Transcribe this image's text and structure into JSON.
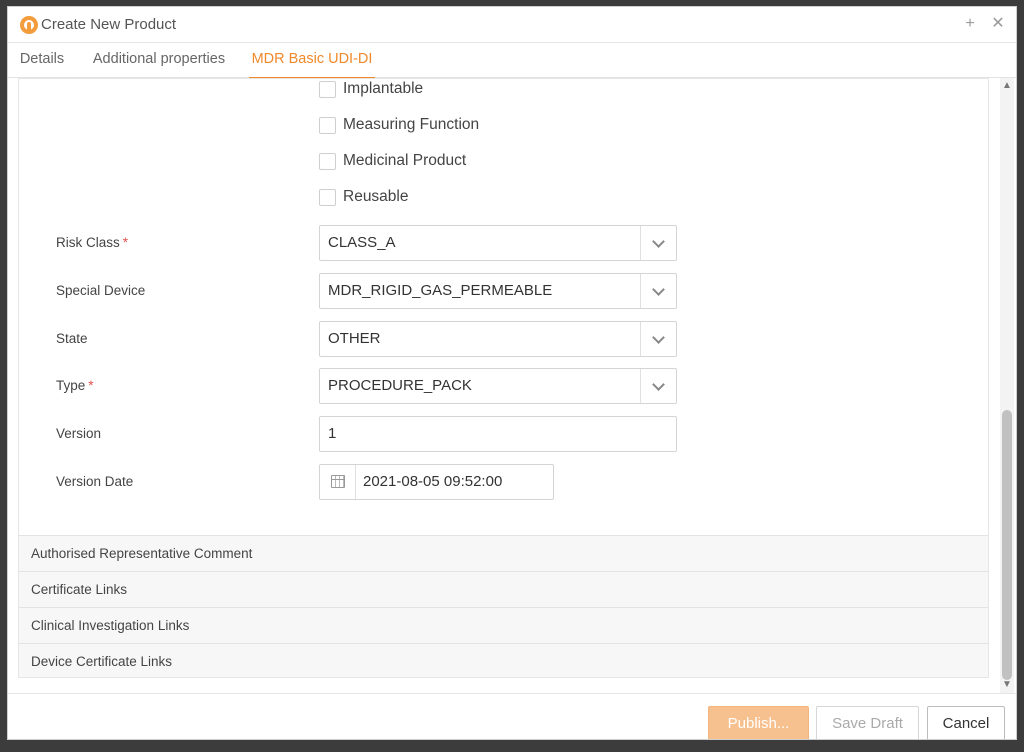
{
  "window": {
    "title": "Create New Product",
    "add_glyph": "+",
    "close_glyph": "✕"
  },
  "tabs": [
    {
      "label": "Details"
    },
    {
      "label": "Additional properties"
    },
    {
      "label": "MDR Basic UDI-DI",
      "active": true
    }
  ],
  "checkboxes": [
    {
      "label": "Implantable",
      "checked": false
    },
    {
      "label": "Measuring Function",
      "checked": false
    },
    {
      "label": "Medicinal Product",
      "checked": false
    },
    {
      "label": "Reusable",
      "checked": false
    }
  ],
  "fields": {
    "risk_class": {
      "label": "Risk Class",
      "required_mark": "*",
      "value": "CLASS_A"
    },
    "special_device": {
      "label": "Special Device",
      "value": "MDR_RIGID_GAS_PERMEABLE"
    },
    "state": {
      "label": "State",
      "value": "OTHER"
    },
    "type": {
      "label": "Type",
      "required_mark": "*",
      "value": "PROCEDURE_PACK"
    },
    "version": {
      "label": "Version",
      "value": "1"
    },
    "version_date": {
      "label": "Version Date",
      "value": "2021-08-05 09:52:00"
    }
  },
  "sections": [
    {
      "label": "Authorised Representative Comment"
    },
    {
      "label": "Certificate Links"
    },
    {
      "label": "Clinical Investigation Links"
    },
    {
      "label": "Device Certificate Links"
    }
  ],
  "footer": {
    "publish_label": "Publish...",
    "draft_label": "Save Draft",
    "cancel_label": "Cancel"
  },
  "scrollbar": {
    "up_glyph": "▲",
    "down_glyph": "▼"
  },
  "colors": {
    "accent": "#f0892b",
    "required": "#e05050",
    "publish_disabled": "#f7c08f"
  }
}
